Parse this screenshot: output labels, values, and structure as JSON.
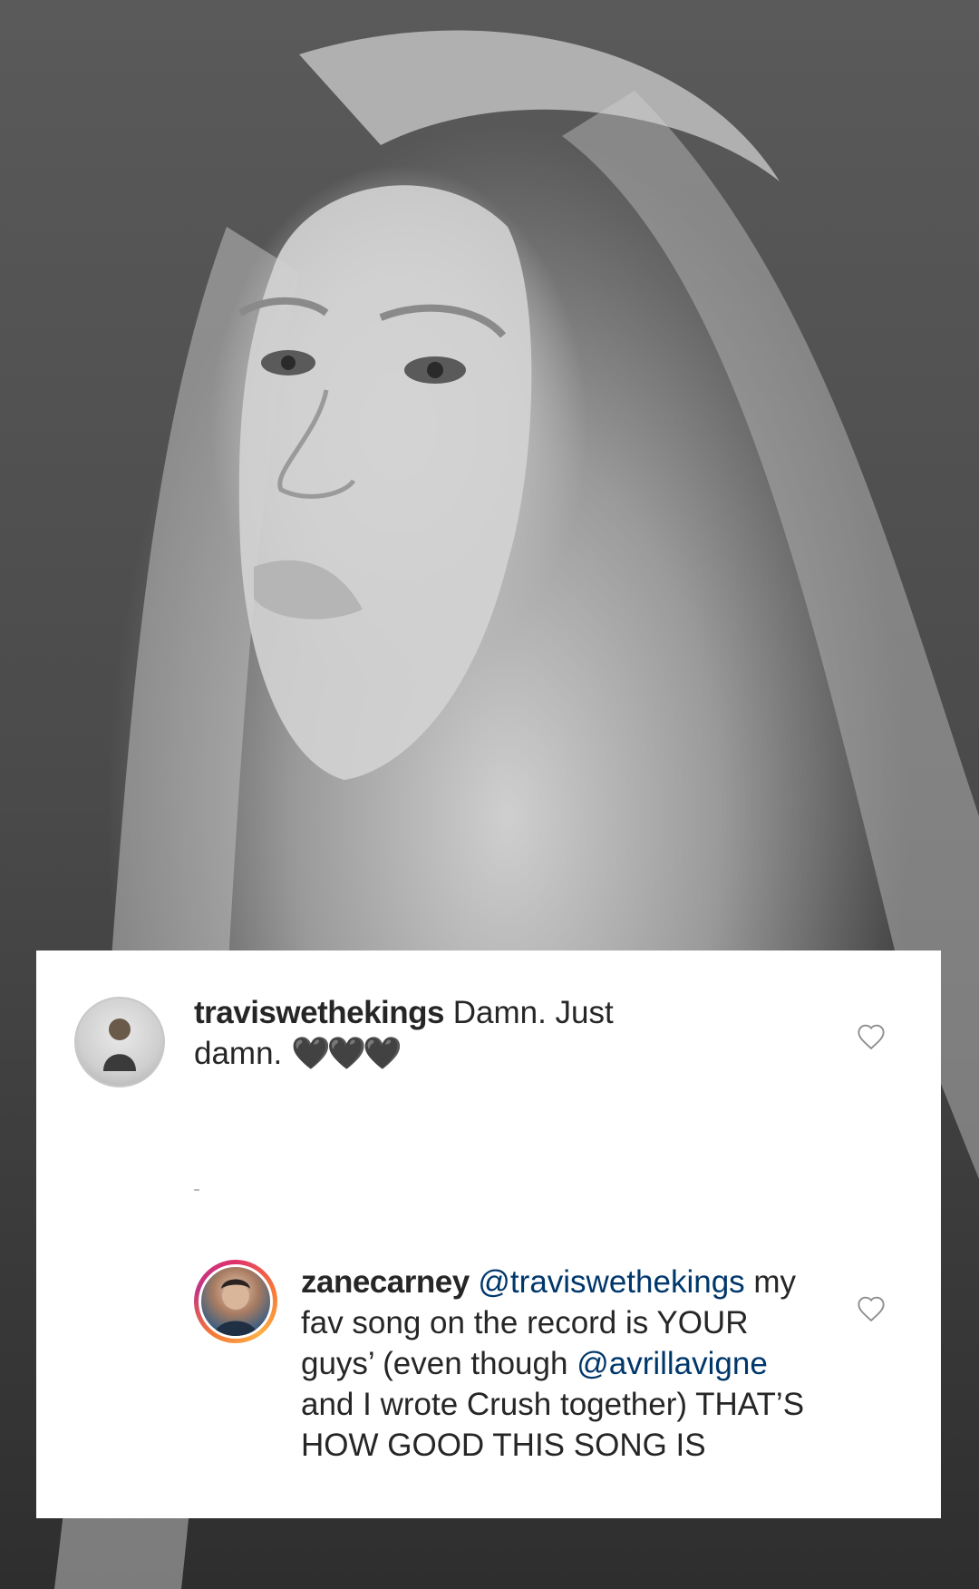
{
  "post_photo": {
    "description_icon": "photo-background"
  },
  "comments": [
    {
      "username": "traviswethekings",
      "text": "Damn.  Just damn.",
      "emoji": "🖤🖤🖤",
      "like_icon": "heart-outline-icon"
    },
    {
      "username": "zanecarney",
      "mention_1": "@traviswethekings",
      "text_1": "my fav song on the record is YOUR guys’ (even though",
      "mention_2": "@avrillavigne",
      "text_2": "and I wrote Crush together) THAT’S HOW GOOD THIS SONG IS",
      "like_icon": "heart-outline-icon",
      "story_ring_colors": [
        "#e1306c",
        "#f77737",
        "#fcaf45",
        "#c13584"
      ]
    }
  ]
}
